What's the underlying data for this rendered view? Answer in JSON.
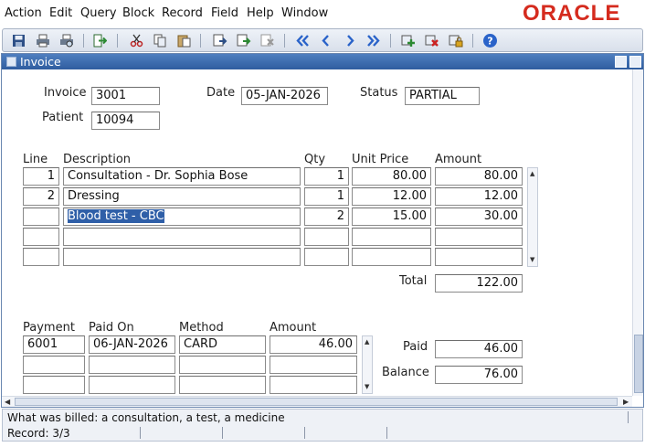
{
  "menu": {
    "action": "Action",
    "edit": "Edit",
    "query": "Query",
    "block": "Block",
    "record": "Record",
    "field": "Field",
    "help": "Help",
    "window": "Window"
  },
  "brand": {
    "logo_text": "ORACLE",
    "color": "#d52b1e"
  },
  "toolbar": {
    "icons": [
      "save-icon",
      "print-icon",
      "print-preview-icon",
      "exit-icon",
      "cut-icon",
      "copy-icon",
      "paste-icon",
      "enter-query-icon",
      "execute-query-icon",
      "cancel-query-icon",
      "first-record-icon",
      "previous-record-icon",
      "next-record-icon",
      "last-record-icon",
      "insert-record-icon",
      "delete-record-icon",
      "lock-record-icon",
      "help-icon"
    ]
  },
  "window": {
    "title": "Invoice"
  },
  "header": {
    "invoice_label": "Invoice",
    "invoice_value": "3001",
    "date_label": "Date",
    "date_value": "05-JAN-2026",
    "status_label": "Status",
    "status_value": "PARTIAL",
    "patient_label": "Patient",
    "patient_value": "10094"
  },
  "lines": {
    "columns": {
      "line": "Line",
      "description": "Description",
      "qty": "Qty",
      "unit_price": "Unit Price",
      "amount": "Amount"
    },
    "rows": [
      {
        "line": "1",
        "description": "Consultation - Dr. Sophia Bose",
        "qty": "1",
        "unit_price": "80.00",
        "amount": "80.00"
      },
      {
        "line": "2",
        "description": "Dressing",
        "qty": "1",
        "unit_price": "12.00",
        "amount": "12.00"
      },
      {
        "line": "",
        "description": "Blood test - CBC",
        "qty": "2",
        "unit_price": "15.00",
        "amount": "30.00"
      },
      {
        "line": "",
        "description": "",
        "qty": "",
        "unit_price": "",
        "amount": ""
      },
      {
        "line": "",
        "description": "",
        "qty": "",
        "unit_price": "",
        "amount": ""
      }
    ],
    "total_label": "Total",
    "total_value": "122.00"
  },
  "payments": {
    "columns": {
      "payment": "Payment",
      "paid_on": "Paid On",
      "method": "Method",
      "amount": "Amount"
    },
    "rows": [
      {
        "payment": "6001",
        "paid_on": "06-JAN-2026",
        "method": "CARD",
        "amount": "46.00"
      },
      {
        "payment": "",
        "paid_on": "",
        "method": "",
        "amount": ""
      },
      {
        "payment": "",
        "paid_on": "",
        "method": "",
        "amount": ""
      }
    ],
    "paid_label": "Paid",
    "paid_value": "46.00",
    "balance_label": "Balance",
    "balance_value": "76.00"
  },
  "status_bar": {
    "message": "What was billed: a consultation, a test, a medicine",
    "record": "Record: 3/3"
  }
}
